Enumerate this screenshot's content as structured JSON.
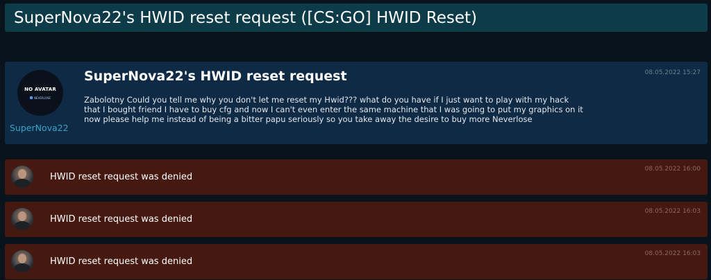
{
  "header": {
    "title": "SuperNova22's HWID reset request ([CS:GO] HWID Reset)"
  },
  "post": {
    "avatar_text": "NO AVATAR",
    "avatar_brand": "NEVERLOSE",
    "username": "SuperNova22",
    "title": "SuperNova22's HWID reset request",
    "body": "Zabolotny Could you tell me why you don't let me reset my Hwid??? what do you have if I just want to play with my hack that I bought friend I have to buy cfg and now I can't even enter the same machine that I was going to put my graphics on it now please help me instead of being a bitter papu seriously so you take away the desire to buy more Neverlose",
    "timestamp": "08.05.2022 15:27"
  },
  "replies": [
    {
      "message": "HWID reset request was denied",
      "timestamp": "08.05.2022 16:00"
    },
    {
      "message": "HWID reset request was denied",
      "timestamp": "08.05.2022 16:03"
    },
    {
      "message": "HWID reset request was denied",
      "timestamp": "08.05.2022 16:03"
    }
  ],
  "colors": {
    "header_bg": "#0d3b48",
    "post_bg": "#0f2a44",
    "reply_bg": "#451810",
    "username": "#38a3cc"
  }
}
